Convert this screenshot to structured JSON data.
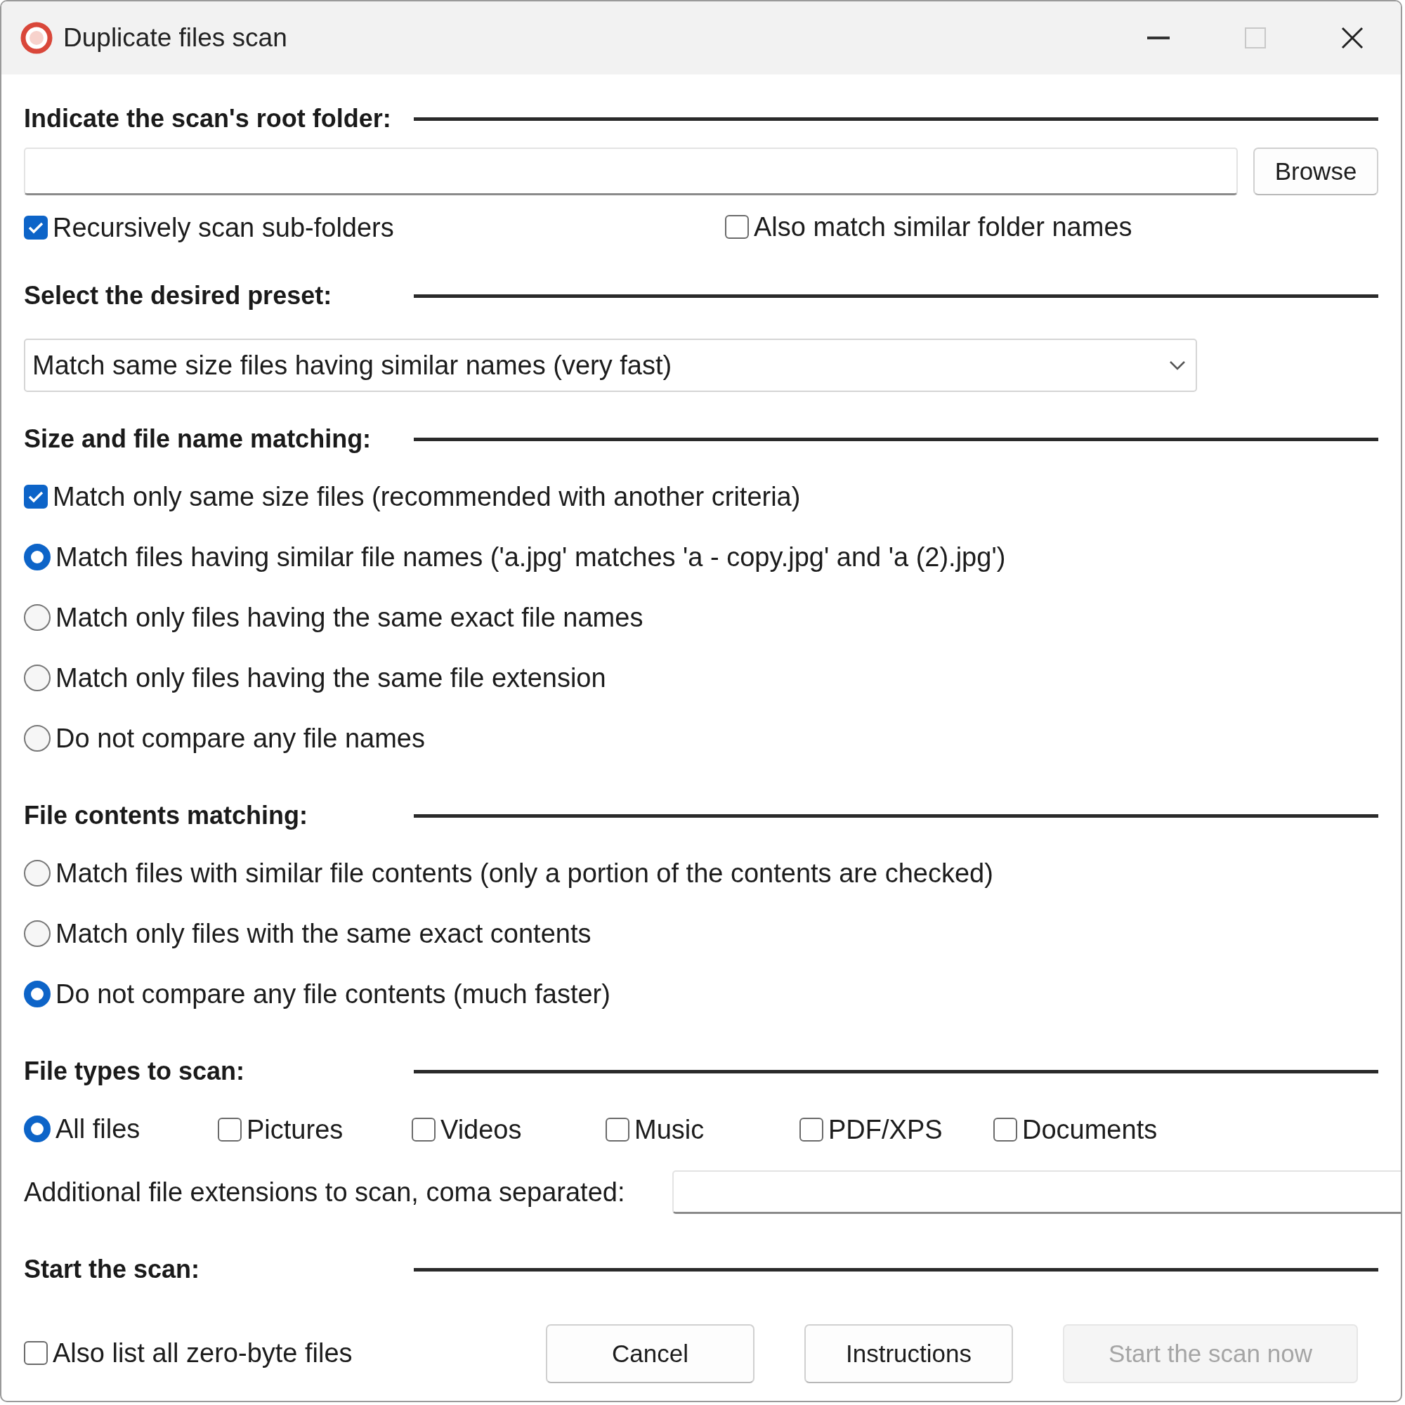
{
  "window": {
    "title": "Duplicate files scan"
  },
  "sections": [
    {
      "heading": "Indicate the scan's root folder:",
      "rows": [
        {
          "kind": "path",
          "button": {
            "label": "Browse",
            "disabled": false
          }
        },
        {
          "kind": "checks-wide",
          "items": [
            {
              "kind": "checkbox",
              "label": "Recursively scan sub-folders",
              "checked": true
            },
            {
              "kind": "checkbox",
              "label": "Also match similar folder names",
              "checked": false
            }
          ]
        }
      ]
    },
    {
      "heading": "Select the desired preset:",
      "rows": [
        {
          "kind": "dropdown",
          "value": "Match same size files having similar names (very fast)"
        }
      ]
    },
    {
      "heading": "Size and file name matching:",
      "rows": [
        {
          "kind": "checks-list",
          "items": [
            {
              "kind": "checkbox",
              "label": "Match only same size files (recommended with another criteria)",
              "checked": true
            },
            {
              "kind": "radio",
              "label": "Match files having similar file names ('a.jpg' matches 'a - copy.jpg' and 'a (2).jpg')",
              "selected": true
            },
            {
              "kind": "radio",
              "label": "Match only files having the same exact file names",
              "selected": false
            },
            {
              "kind": "radio",
              "label": "Match only files having the same file extension",
              "selected": false
            },
            {
              "kind": "radio",
              "label": "Do not compare any file names",
              "selected": false
            }
          ]
        }
      ]
    },
    {
      "heading": "File contents matching:",
      "rows": [
        {
          "kind": "checks-list",
          "items": [
            {
              "kind": "radio",
              "label": "Match files with similar file contents (only a portion of the contents are checked)",
              "selected": false
            },
            {
              "kind": "radio",
              "label": "Match only files with the same exact contents",
              "selected": false
            },
            {
              "kind": "radio",
              "label": "Do not compare any file contents (much faster)",
              "selected": true
            }
          ]
        }
      ]
    },
    {
      "heading": "File types to scan:",
      "rows": [
        {
          "kind": "checks-grid",
          "items": [
            {
              "kind": "radio",
              "label": "All files",
              "selected": true
            },
            {
              "kind": "checkbox",
              "label": "Pictures",
              "checked": false
            },
            {
              "kind": "checkbox",
              "label": "Videos",
              "checked": false
            },
            {
              "kind": "checkbox",
              "label": "Music",
              "checked": false
            },
            {
              "kind": "checkbox",
              "label": "PDF/XPS",
              "checked": false
            },
            {
              "kind": "checkbox",
              "label": "Documents",
              "checked": false
            }
          ]
        },
        {
          "kind": "labeled-field",
          "label": "Additional file extensions to scan, coma separated:"
        }
      ]
    },
    {
      "heading": "Start the scan:",
      "rows": [
        {
          "kind": "actions",
          "items": [
            {
              "kind": "checkbox",
              "label": "Also list all zero-byte files",
              "checked": false
            },
            {
              "kind": "button",
              "label": "Cancel",
              "disabled": false
            },
            {
              "kind": "button",
              "label": "Instructions",
              "disabled": false
            },
            {
              "kind": "button",
              "label": "Start the scan now",
              "disabled": true
            }
          ]
        }
      ]
    }
  ]
}
